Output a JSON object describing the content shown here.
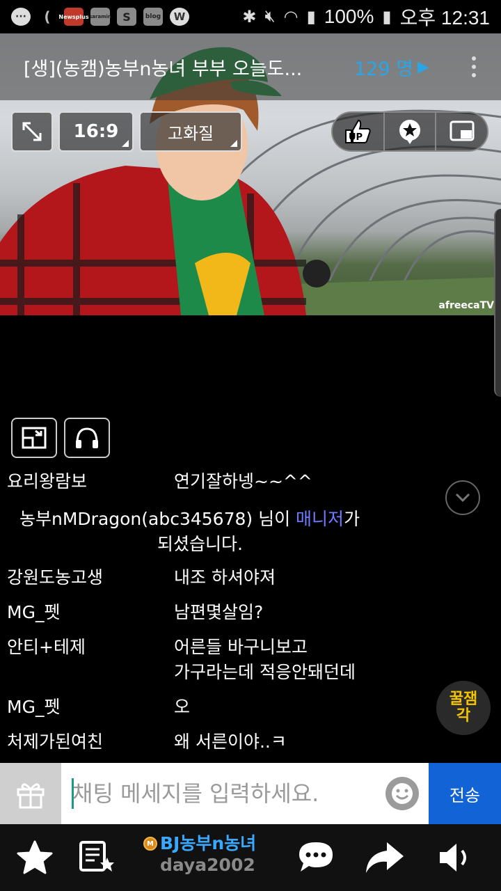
{
  "status_bar": {
    "app_icons": [
      "(",
      "Newsplus",
      "saramin",
      "S",
      "blog",
      "W"
    ],
    "battery": "100%",
    "time": "오후 12:31"
  },
  "stream": {
    "title": "[생](농캠)농부n농녀 부부 오늘도...",
    "viewers": "129 명",
    "aspect_label": "16:9",
    "quality_label": "고화질",
    "watermark": "afreecaTV"
  },
  "chat": {
    "messages": [
      {
        "user": "요리왕람보",
        "text": "연기잘하넹~~^^"
      },
      {
        "user": "강원도농고생",
        "text": "내조 하셔야져"
      },
      {
        "user": "MG_펫",
        "text": "남편몇살임?"
      },
      {
        "user": "안티+테제",
        "text": "어른들 바구니보고\n가구라는데 적응안돼던데"
      },
      {
        "user": "MG_펫",
        "text": "오"
      },
      {
        "user": "처제가된여친",
        "text": "왜 서른이야..ㅋ"
      }
    ],
    "notice": {
      "prefix": "농부nMDragon(abc345678) 님이 ",
      "role": "매니저",
      "suffix": "가",
      "line2": "되셨습니다."
    },
    "honey_badge": [
      "꿀잼",
      "각"
    ]
  },
  "input": {
    "placeholder": "채팅 메세지를 입력하세요.",
    "send_label": "전송"
  },
  "bottom_nav": {
    "bj_name": "BJ농부n농녀",
    "bj_id": "daya2002",
    "medal": "M"
  },
  "colors": {
    "viewer_accent": "#2aa6e6",
    "manager_role": "#6f7cff",
    "send_button": "#1264d6",
    "bj_name": "#39a8ff"
  }
}
